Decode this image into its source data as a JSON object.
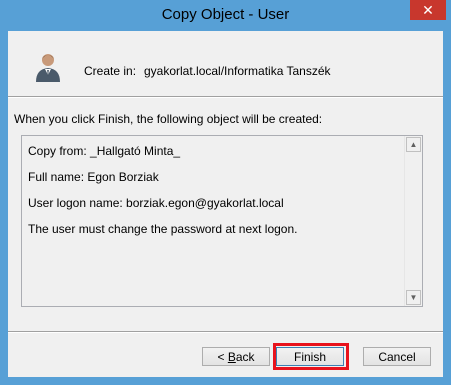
{
  "window": {
    "title": "Copy Object - User",
    "close_label": "✕"
  },
  "header": {
    "created_in_label": "Create in:",
    "created_in_path": "gyakorlat.local/Informatika Tanszék",
    "icon": "user-icon"
  },
  "summary": {
    "intro": "When you click Finish, the following object will be created:",
    "lines": [
      "Copy from: _Hallgató Minta_",
      "Full name: Egon Borziak",
      "User logon name: borziak.egon@gyakorlat.local",
      "The user must change the password at next logon."
    ]
  },
  "buttons": {
    "back_prefix": "< ",
    "back_mnemonic": "B",
    "back_rest": "ack",
    "finish": "Finish",
    "cancel": "Cancel"
  },
  "colors": {
    "titlebar": "#57a0d6",
    "close_button": "#c8372d",
    "highlight": "#e8121c",
    "dialog_bg": "#f0f0f0"
  }
}
